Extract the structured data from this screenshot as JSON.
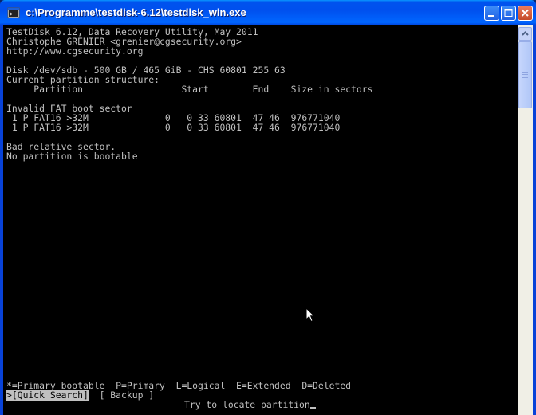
{
  "window": {
    "title": "c:\\Programme\\testdisk-6.12\\testdisk_win.exe"
  },
  "console": {
    "lines": [
      "TestDisk 6.12, Data Recovery Utility, May 2011",
      "Christophe GRENIER <grenier@cgsecurity.org>",
      "http://www.cgsecurity.org",
      "",
      "Disk /dev/sdb - 500 GB / 465 GiB - CHS 60801 255 63",
      "Current partition structure:",
      "     Partition                  Start        End    Size in sectors",
      "",
      "Invalid FAT boot sector",
      " 1 P FAT16 >32M              0   0 33 60801  47 46  976771040",
      " 1 P FAT16 >32M              0   0 33 60801  47 46  976771040",
      "",
      "Bad relative sector.",
      "No partition is bootable"
    ],
    "legend": "*=Primary bootable  P=Primary  L=Logical  E=Extended  D=Deleted",
    "menu": {
      "quick_search": ">[Quick Search]",
      "backup": "[ Backup ]"
    },
    "status": "Try to locate partition"
  },
  "colors": {
    "console_bg": "#000000",
    "console_fg": "#c0c0c0",
    "titlebar": "#0053ee"
  },
  "icons": {
    "title": "console-window-icon",
    "minimize": "minimize-icon",
    "maximize": "maximize-icon",
    "close": "close-icon",
    "pointer": "mouse-pointer-icon"
  }
}
